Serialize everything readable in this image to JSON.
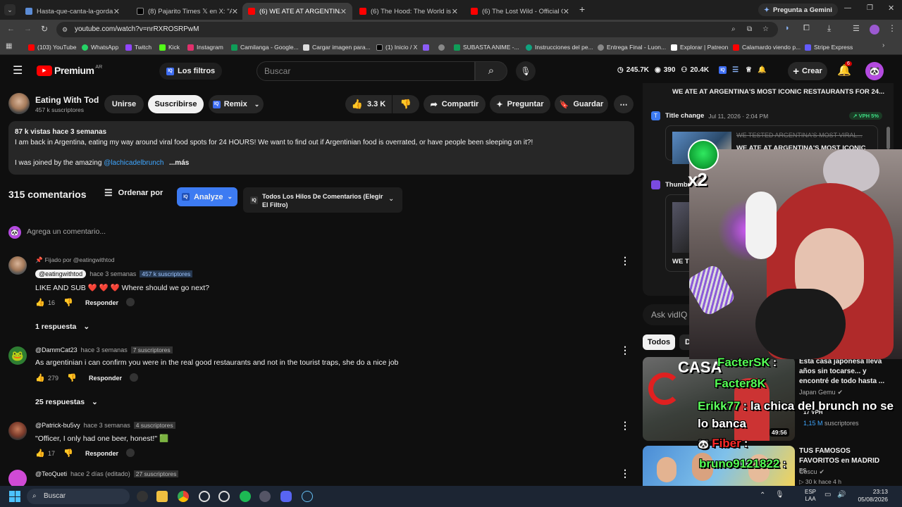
{
  "browser": {
    "tabs": [
      {
        "title": "Hasta-que-canta-la-gorda.jpg",
        "color": "#5b8cd6"
      },
      {
        "title": "(8) Pajarito Times 𝕏 en X: \"Algu",
        "color": "#222"
      },
      {
        "title": "(6) WE ATE AT ARGENTINA'S M",
        "color": "#ff0000"
      },
      {
        "title": "(6) The Hood: The World is His",
        "color": "#ff0000"
      },
      {
        "title": "(6) The Lost Wild - Official Gam",
        "color": "#ff0000"
      }
    ],
    "gemini_label": "Pregunta a Gemini",
    "url": "youtube.com/watch?v=nrRXROSRPwM",
    "bookmarks": [
      "(103) YouTube",
      "WhatsApp",
      "Twitch",
      "Kick",
      "Instagram",
      "Camilanga - Google...",
      "Cargar imagen para...",
      "(1) Inicio / X",
      "",
      "SUBASTA ANIME -...",
      "Instrucciones del pe...",
      "Entrega Final - Luon...",
      "Explorar | Patreon",
      "Calamardo viendo p...",
      "Stripe Express"
    ]
  },
  "yt": {
    "logo_text": "Premium",
    "region": "AR",
    "filters_label": "Los filtros",
    "search_placeholder": "Buscar",
    "stats": {
      "views": "245.7K",
      "watching": "390",
      "subs": "20.4K"
    },
    "create_label": "Crear",
    "notif_count": "6"
  },
  "channel": {
    "name": "Eating With Tod",
    "subs": "457 k suscriptores",
    "join_label": "Unirse",
    "subscribe_label": "Suscribirse",
    "remix_label": "Remix",
    "likes": "3.3 K",
    "share_label": "Compartir",
    "ask_label": "Preguntar",
    "save_label": "Guardar"
  },
  "description": {
    "meta": "87 k vistas  hace 3 semanas",
    "line1": "I am back in Argentina, eating my way around viral food spots for 24 HOURS! We want to find out if Argentinian food is overrated, or have people been sleeping on it?!",
    "line2_prefix": "I was joined by the amazing ",
    "line2_link": "@lachicadelbrunch",
    "more": "...más"
  },
  "comments_header": {
    "count": "315 comentarios",
    "sort_label": "Ordenar por",
    "analyze_label": "Analyze",
    "thread_filter": "Todos Los Hilos De Comentarios (Elegir El Filtro)",
    "add_placeholder": "Agrega un comentario..."
  },
  "comments": [
    {
      "pinned": "Fijado por @eatingwithtod",
      "author": "@eatingwithtod",
      "time": "hace 3 semanas",
      "badge": "457 k suscriptores",
      "text": "LIKE AND SUB ❤️ ❤️ ❤️  Where should we go next?",
      "likes": "16",
      "reply": "Responder",
      "replies": "1 respuesta"
    },
    {
      "author": "@DammCat23",
      "time": "hace 3 semanas",
      "badge": "7 suscriptores",
      "text": "As argentinian i can confirm you were in the real good restaurants and not in the tourist traps, she do a nice job",
      "likes": "279",
      "reply": "Responder",
      "replies": "25 respuestas"
    },
    {
      "author": "@Patrick-bu5vy",
      "time": "hace 3 semanas",
      "badge": "4 suscriptores",
      "text": "\"Officer, I only had one beer, honest!\" 🟩",
      "likes": "17",
      "reply": "Responder"
    },
    {
      "author": "@TeoQueti",
      "time": "hace 2 días (editado)",
      "badge": "27 suscriptores"
    }
  ],
  "sidebar": {
    "current_title": "WE ATE AT ARGENTINA'S MOST ICONIC RESTAURANTS FOR 24...",
    "title_change_label": "Title change",
    "title_change_date": "Jul 11, 2026 · 2:04 PM",
    "vph": "↗ VPH 5%",
    "old_title": "WE TESTED ARGENTINA'S MOST VIRAL...",
    "new_title": "WE ATE AT ARGENTINA'S MOST ICONIC",
    "thumb_label": "Thumbn",
    "we_te": "WE TE",
    "ask_vidiq": "Ask vidIQ",
    "chip_all": "Todos",
    "chip_d": "D",
    "video1": {
      "title": "Esta casa japonesa lleva años sin tocarse... y encontré de todo hasta ...",
      "channel": "Japan Gemu",
      "vph": "17 VPH",
      "subs_num": "1,15 M",
      "subs": "suscriptores",
      "duration": "49:56",
      "thumb_text": "CASA"
    },
    "video2": {
      "title": "TUS FAMOSOS FAVORITOS en MADRID",
      "lang": "ES",
      "channel": "Coscu",
      "stats": "▷ 30 k  hace 4 h"
    }
  },
  "stream_chat": [
    {
      "user": "FacterSK",
      "text": ":",
      "color": "#55ff55"
    },
    {
      "user": "Facter8K",
      "text": "",
      "color": "#55ff55"
    },
    {
      "user": "Erikk77",
      "text": ": la chica del brunch no se lo banca",
      "color": "#5cff5c"
    },
    {
      "user": "Fiber",
      "text": ":",
      "color": "#ff2a2a"
    },
    {
      "user": "bruno9121822",
      "text": ":",
      "color": "#55ff55"
    }
  ],
  "overlay": {
    "multiplier": "x2"
  },
  "taskbar": {
    "search": "Buscar",
    "lang": "ESP",
    "layout": "LAA",
    "time": "23:13",
    "date": "05/08/2026"
  }
}
